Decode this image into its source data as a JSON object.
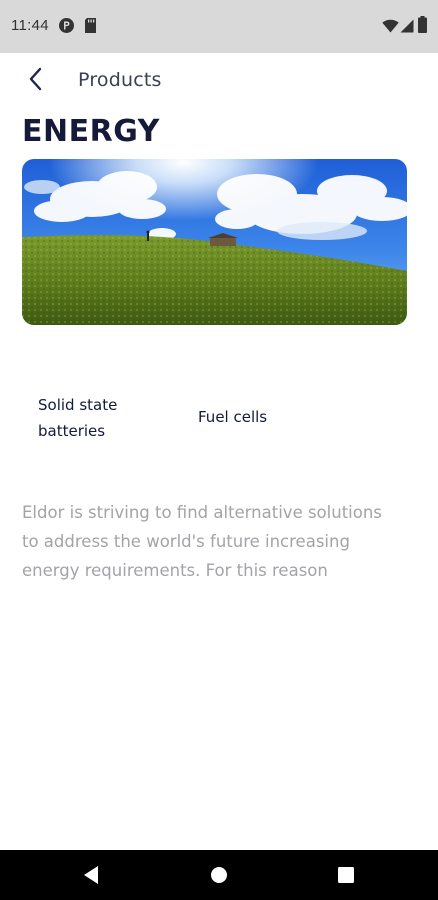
{
  "status_bar": {
    "time": "11:44",
    "left_icons": [
      "p-badge-icon",
      "sd-card-icon"
    ],
    "right_icons": [
      "wifi-icon",
      "cell-signal-icon",
      "battery-icon"
    ]
  },
  "app_bar": {
    "back_icon": "chevron-left-icon",
    "title": "Products"
  },
  "page": {
    "title": "ENERGY",
    "hero_image": "grassy hill under blue sky with clouds",
    "chips": [
      {
        "label": "Solid state batteries"
      },
      {
        "label": "Fuel cells"
      }
    ],
    "description": "Eldor is striving to find alternative solutions to address the world's future increasing energy requirements. For this reason"
  },
  "nav_bar": {
    "buttons": [
      "back-triangle-icon",
      "home-circle-icon",
      "recents-square-icon"
    ]
  },
  "colors": {
    "status_bar_bg": "#d9d9d9",
    "title": "#161a3a",
    "body_text": "#a3a3a8",
    "nav_bar_bg": "#000000"
  }
}
